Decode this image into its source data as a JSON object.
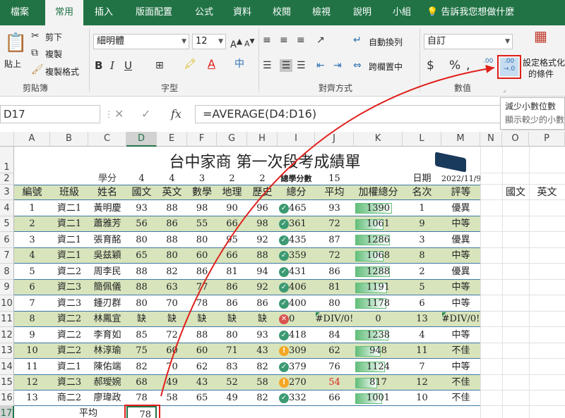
{
  "tabs": [
    "檔案",
    "常用",
    "插入",
    "版面配置",
    "公式",
    "資料",
    "校閱",
    "檢視",
    "說明",
    "小組"
  ],
  "tell_me": "告訴我您想做什麼",
  "ribbon": {
    "paste": "貼上",
    "cut": "剪下",
    "copy": "複製",
    "format_painter": "複製格式",
    "clipboard": "剪貼簿",
    "font_name": "細明體",
    "font_size": "12",
    "font_group": "字型",
    "wrap_text": "自動換列",
    "merge_center": "跨欄置中",
    "alignment": "對齊方式",
    "number_format": "自訂",
    "number": "數值",
    "conditional_1": "設定格式化",
    "conditional_2": "的條件",
    "dec_inc": ".00",
    "dec_dec": "→.0",
    "bold": "B",
    "italic": "I",
    "underline": "U",
    "font_color_glyph": "A",
    "phonetic": "中"
  },
  "tooltip": {
    "title": "減少小數位數",
    "desc": "顯示較少的小數位數"
  },
  "namebox": "D17",
  "formula": "=AVERAGE(D4:D16)",
  "columns": [
    "A",
    "B",
    "C",
    "D",
    "E",
    "F",
    "G",
    "H",
    "I",
    "J",
    "K",
    "L",
    "M",
    "N",
    "O",
    "P"
  ],
  "rows": [
    "1",
    "2",
    "3",
    "4",
    "5",
    "6",
    "7",
    "8",
    "9",
    "10",
    "11",
    "12",
    "13",
    "14",
    "15",
    "16",
    "17"
  ],
  "sheet": {
    "title": "台中家商  第一次段考成績單",
    "row2": {
      "label": "學分",
      "c1": "4",
      "c2": "4",
      "c3": "3",
      "c4": "2",
      "c5": "2",
      "total_label": "總學分數",
      "total": "15",
      "date_label": "日期",
      "date": "2022/11/9"
    },
    "headers": [
      "編號",
      "班級",
      "姓名",
      "國文",
      "英文",
      "數學",
      "地理",
      "歷史",
      "總分",
      "平均",
      "加權總分",
      "名次",
      "評等"
    ],
    "extra_headers": [
      "國文",
      "英文"
    ],
    "data": [
      {
        "no": "1",
        "cls": "資二1",
        "name": "黃明慶",
        "s1": "93",
        "s2": "88",
        "s3": "98",
        "s4": "90",
        "s5": "96",
        "icon": "ok",
        "total": "465",
        "avg": "93",
        "w": "1390",
        "rank": "1",
        "grade": "優異",
        "pct": 0.83
      },
      {
        "no": "2",
        "cls": "資二1",
        "name": "蕭雅芳",
        "s1": "56",
        "s2": "86",
        "s3": "55",
        "s4": "66",
        "s5": "98",
        "icon": "ok",
        "total": "361",
        "avg": "72",
        "w": "1061",
        "rank": "9",
        "grade": "中等",
        "pct": 0.63
      },
      {
        "no": "3",
        "cls": "資二1",
        "name": "張育酩",
        "s1": "80",
        "s2": "88",
        "s3": "80",
        "s4": "95",
        "s5": "92",
        "icon": "ok",
        "total": "435",
        "avg": "87",
        "w": "1286",
        "rank": "3",
        "grade": "優異",
        "pct": 0.77
      },
      {
        "no": "4",
        "cls": "資二1",
        "name": "吳兹穎",
        "s1": "65",
        "s2": "80",
        "s3": "60",
        "s4": "66",
        "s5": "88",
        "icon": "ok",
        "total": "359",
        "avg": "72",
        "w": "1068",
        "rank": "8",
        "grade": "中等",
        "pct": 0.64
      },
      {
        "no": "5",
        "cls": "資二2",
        "name": "周李民",
        "s1": "88",
        "s2": "82",
        "s3": "86",
        "s4": "81",
        "s5": "94",
        "icon": "ok",
        "total": "431",
        "avg": "86",
        "w": "1288",
        "rank": "2",
        "grade": "優異",
        "pct": 0.77
      },
      {
        "no": "6",
        "cls": "資二3",
        "name": "簡佩儀",
        "s1": "88",
        "s2": "63",
        "s3": "77",
        "s4": "86",
        "s5": "92",
        "icon": "ok",
        "total": "406",
        "avg": "81",
        "w": "1191",
        "rank": "5",
        "grade": "中等",
        "pct": 0.71
      },
      {
        "no": "7",
        "cls": "資二3",
        "name": "鍾刃群",
        "s1": "80",
        "s2": "70",
        "s3": "78",
        "s4": "86",
        "s5": "86",
        "icon": "ok",
        "total": "400",
        "avg": "80",
        "w": "1178",
        "rank": "6",
        "grade": "中等",
        "pct": 0.7
      },
      {
        "no": "8",
        "cls": "資二2",
        "name": "林鳳宜",
        "s1": "缺",
        "s2": "缺",
        "s3": "缺",
        "s4": "缺",
        "s5": "缺",
        "icon": "bad",
        "total": "0",
        "avg": "#DIV/0!",
        "w": "0",
        "rank": "13",
        "grade": "#DIV/0!",
        "pct": 0
      },
      {
        "no": "9",
        "cls": "資二2",
        "name": "李育如",
        "s1": "85",
        "s2": "72",
        "s3": "88",
        "s4": "80",
        "s5": "93",
        "icon": "ok",
        "total": "418",
        "avg": "84",
        "w": "1238",
        "rank": "4",
        "grade": "中等",
        "pct": 0.74
      },
      {
        "no": "10",
        "cls": "資二2",
        "name": "林淳瑜",
        "s1": "75",
        "s2": "60",
        "s3": "60",
        "s4": "71",
        "s5": "43",
        "icon": "warn",
        "total": "309",
        "avg": "62",
        "w": "948",
        "rank": "11",
        "grade": "不佳",
        "pct": 0.57
      },
      {
        "no": "11",
        "cls": "資二1",
        "name": "陳佑端",
        "s1": "82",
        "s2": "70",
        "s3": "62",
        "s4": "83",
        "s5": "82",
        "icon": "ok",
        "total": "379",
        "avg": "76",
        "w": "1124",
        "rank": "7",
        "grade": "中等",
        "pct": 0.67
      },
      {
        "no": "12",
        "cls": "資二3",
        "name": "郝璦婉",
        "s1": "68",
        "s2": "49",
        "s3": "43",
        "s4": "52",
        "s5": "58",
        "icon": "warn",
        "total": "270",
        "avg": "54",
        "w": "817",
        "rank": "12",
        "grade": "不佳",
        "pct": 0.49
      },
      {
        "no": "13",
        "cls": "商二2",
        "name": "廖瑋政",
        "s1": "78",
        "s2": "58",
        "s3": "65",
        "s4": "49",
        "s5": "82",
        "icon": "ok",
        "total": "332",
        "avg": "66",
        "w": "1001",
        "rank": "10",
        "grade": "不佳",
        "pct": 0.6
      }
    ],
    "avg_label": "平均",
    "avg_value": "78"
  },
  "colors": {
    "excel_green": "#217346",
    "band": "#d8e4bc",
    "border_blue": "#3f78a7",
    "highlight_red": "#e0201b",
    "low_avg_red": "#e0201b"
  }
}
